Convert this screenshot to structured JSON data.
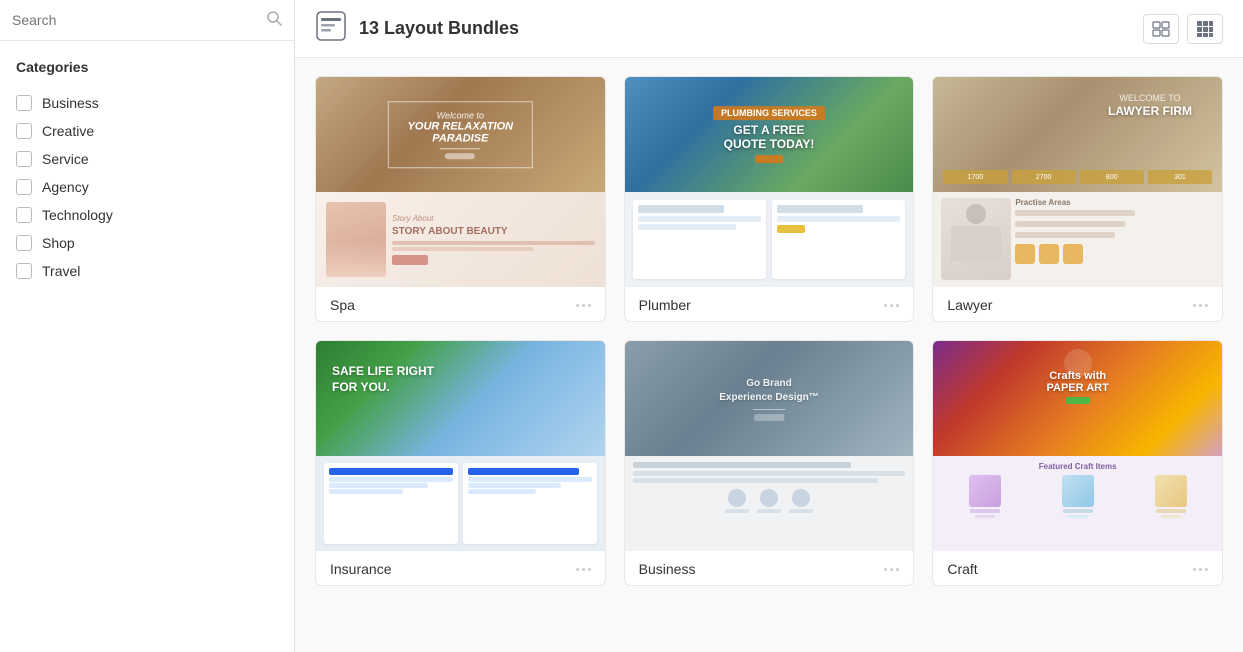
{
  "sidebar": {
    "search": {
      "placeholder": "Search",
      "value": ""
    },
    "categories_title": "Categories",
    "categories": [
      {
        "id": "business",
        "label": "Business",
        "checked": false
      },
      {
        "id": "creative",
        "label": "Creative",
        "checked": false
      },
      {
        "id": "service",
        "label": "Service",
        "checked": false
      },
      {
        "id": "agency",
        "label": "Agency",
        "checked": false
      },
      {
        "id": "technology",
        "label": "Technology",
        "checked": false
      },
      {
        "id": "shop",
        "label": "Shop",
        "checked": false
      },
      {
        "id": "travel",
        "label": "Travel",
        "checked": false
      }
    ]
  },
  "header": {
    "bundle_count_label": "13 Layout Bundles"
  },
  "layouts": [
    {
      "id": "spa",
      "name": "Spa",
      "type": "spa"
    },
    {
      "id": "plumber",
      "name": "Plumber",
      "type": "plumber"
    },
    {
      "id": "lawyer",
      "name": "Lawyer",
      "type": "lawyer"
    },
    {
      "id": "insurance",
      "name": "Insurance",
      "type": "insurance"
    },
    {
      "id": "business",
      "name": "Business",
      "type": "business"
    },
    {
      "id": "craft",
      "name": "Craft",
      "type": "craft"
    }
  ],
  "icons": {
    "search": "🔍",
    "bundle": "▦",
    "list_view": "☰",
    "grid_view": "⊞"
  }
}
